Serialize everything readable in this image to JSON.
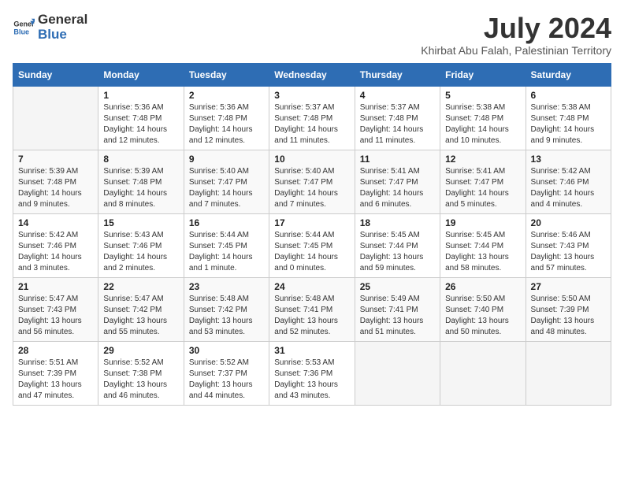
{
  "logo": {
    "text_general": "General",
    "text_blue": "Blue"
  },
  "title": "July 2024",
  "subtitle": "Khirbat Abu Falah, Palestinian Territory",
  "days_header": [
    "Sunday",
    "Monday",
    "Tuesday",
    "Wednesday",
    "Thursday",
    "Friday",
    "Saturday"
  ],
  "weeks": [
    [
      {
        "day": "",
        "info": ""
      },
      {
        "day": "1",
        "info": "Sunrise: 5:36 AM\nSunset: 7:48 PM\nDaylight: 14 hours\nand 12 minutes."
      },
      {
        "day": "2",
        "info": "Sunrise: 5:36 AM\nSunset: 7:48 PM\nDaylight: 14 hours\nand 12 minutes."
      },
      {
        "day": "3",
        "info": "Sunrise: 5:37 AM\nSunset: 7:48 PM\nDaylight: 14 hours\nand 11 minutes."
      },
      {
        "day": "4",
        "info": "Sunrise: 5:37 AM\nSunset: 7:48 PM\nDaylight: 14 hours\nand 11 minutes."
      },
      {
        "day": "5",
        "info": "Sunrise: 5:38 AM\nSunset: 7:48 PM\nDaylight: 14 hours\nand 10 minutes."
      },
      {
        "day": "6",
        "info": "Sunrise: 5:38 AM\nSunset: 7:48 PM\nDaylight: 14 hours\nand 9 minutes."
      }
    ],
    [
      {
        "day": "7",
        "info": "Sunrise: 5:39 AM\nSunset: 7:48 PM\nDaylight: 14 hours\nand 9 minutes."
      },
      {
        "day": "8",
        "info": "Sunrise: 5:39 AM\nSunset: 7:48 PM\nDaylight: 14 hours\nand 8 minutes."
      },
      {
        "day": "9",
        "info": "Sunrise: 5:40 AM\nSunset: 7:47 PM\nDaylight: 14 hours\nand 7 minutes."
      },
      {
        "day": "10",
        "info": "Sunrise: 5:40 AM\nSunset: 7:47 PM\nDaylight: 14 hours\nand 7 minutes."
      },
      {
        "day": "11",
        "info": "Sunrise: 5:41 AM\nSunset: 7:47 PM\nDaylight: 14 hours\nand 6 minutes."
      },
      {
        "day": "12",
        "info": "Sunrise: 5:41 AM\nSunset: 7:47 PM\nDaylight: 14 hours\nand 5 minutes."
      },
      {
        "day": "13",
        "info": "Sunrise: 5:42 AM\nSunset: 7:46 PM\nDaylight: 14 hours\nand 4 minutes."
      }
    ],
    [
      {
        "day": "14",
        "info": "Sunrise: 5:42 AM\nSunset: 7:46 PM\nDaylight: 14 hours\nand 3 minutes."
      },
      {
        "day": "15",
        "info": "Sunrise: 5:43 AM\nSunset: 7:46 PM\nDaylight: 14 hours\nand 2 minutes."
      },
      {
        "day": "16",
        "info": "Sunrise: 5:44 AM\nSunset: 7:45 PM\nDaylight: 14 hours\nand 1 minute."
      },
      {
        "day": "17",
        "info": "Sunrise: 5:44 AM\nSunset: 7:45 PM\nDaylight: 14 hours\nand 0 minutes."
      },
      {
        "day": "18",
        "info": "Sunrise: 5:45 AM\nSunset: 7:44 PM\nDaylight: 13 hours\nand 59 minutes."
      },
      {
        "day": "19",
        "info": "Sunrise: 5:45 AM\nSunset: 7:44 PM\nDaylight: 13 hours\nand 58 minutes."
      },
      {
        "day": "20",
        "info": "Sunrise: 5:46 AM\nSunset: 7:43 PM\nDaylight: 13 hours\nand 57 minutes."
      }
    ],
    [
      {
        "day": "21",
        "info": "Sunrise: 5:47 AM\nSunset: 7:43 PM\nDaylight: 13 hours\nand 56 minutes."
      },
      {
        "day": "22",
        "info": "Sunrise: 5:47 AM\nSunset: 7:42 PM\nDaylight: 13 hours\nand 55 minutes."
      },
      {
        "day": "23",
        "info": "Sunrise: 5:48 AM\nSunset: 7:42 PM\nDaylight: 13 hours\nand 53 minutes."
      },
      {
        "day": "24",
        "info": "Sunrise: 5:48 AM\nSunset: 7:41 PM\nDaylight: 13 hours\nand 52 minutes."
      },
      {
        "day": "25",
        "info": "Sunrise: 5:49 AM\nSunset: 7:41 PM\nDaylight: 13 hours\nand 51 minutes."
      },
      {
        "day": "26",
        "info": "Sunrise: 5:50 AM\nSunset: 7:40 PM\nDaylight: 13 hours\nand 50 minutes."
      },
      {
        "day": "27",
        "info": "Sunrise: 5:50 AM\nSunset: 7:39 PM\nDaylight: 13 hours\nand 48 minutes."
      }
    ],
    [
      {
        "day": "28",
        "info": "Sunrise: 5:51 AM\nSunset: 7:39 PM\nDaylight: 13 hours\nand 47 minutes."
      },
      {
        "day": "29",
        "info": "Sunrise: 5:52 AM\nSunset: 7:38 PM\nDaylight: 13 hours\nand 46 minutes."
      },
      {
        "day": "30",
        "info": "Sunrise: 5:52 AM\nSunset: 7:37 PM\nDaylight: 13 hours\nand 44 minutes."
      },
      {
        "day": "31",
        "info": "Sunrise: 5:53 AM\nSunset: 7:36 PM\nDaylight: 13 hours\nand 43 minutes."
      },
      {
        "day": "",
        "info": ""
      },
      {
        "day": "",
        "info": ""
      },
      {
        "day": "",
        "info": ""
      }
    ]
  ]
}
